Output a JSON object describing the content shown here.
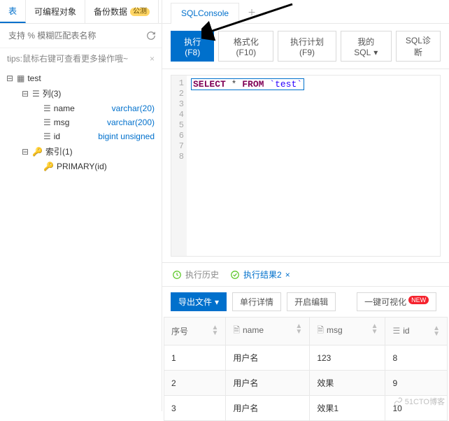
{
  "left": {
    "tabs": [
      "表",
      "可编程对象",
      "备份数据"
    ],
    "backup_badge": "公测",
    "search_placeholder": "支持 % 模糊匹配表名称",
    "tips": "tips:鼠标右键可查看更多操作哦~",
    "tree": {
      "root": "test",
      "columns_label": "列(3)",
      "columns": [
        {
          "name": "name",
          "type": "varchar(20)"
        },
        {
          "name": "msg",
          "type": "varchar(200)"
        },
        {
          "name": "id",
          "type": "bigint unsigned"
        }
      ],
      "index_label": "索引(1)",
      "indexes": [
        "PRIMARY(id)"
      ]
    }
  },
  "right": {
    "top_tab": "SQLConsole",
    "toolbar": {
      "run": "执行(F8)",
      "format": "格式化(F10)",
      "plan": "执行计划(F9)",
      "mysql": "我的SQL",
      "diag": "SQL诊断"
    },
    "code": {
      "kw1": "SELECT",
      "star": "*",
      "kw2": "FROM",
      "tbl": "`test`"
    },
    "gutter": [
      "1",
      "2",
      "3",
      "4",
      "5",
      "6",
      "7",
      "8"
    ],
    "result_tabs": {
      "history": "执行历史",
      "result": "执行结果2"
    },
    "result_toolbar": {
      "export": "导出文件",
      "single": "单行详情",
      "edit": "开启编辑",
      "visual": "一键可视化",
      "new_badge": "NEW"
    },
    "table": {
      "headers": {
        "seq": "序号",
        "name": "name",
        "msg": "msg",
        "id": "id"
      },
      "rows": [
        {
          "seq": "1",
          "name": "用户名",
          "msg": "123",
          "id": "8"
        },
        {
          "seq": "2",
          "name": "用户名",
          "msg": "效果",
          "id": "9"
        },
        {
          "seq": "3",
          "name": "用户名",
          "msg": "效果1",
          "id": "10"
        }
      ]
    }
  },
  "watermark": "51CTO博客"
}
